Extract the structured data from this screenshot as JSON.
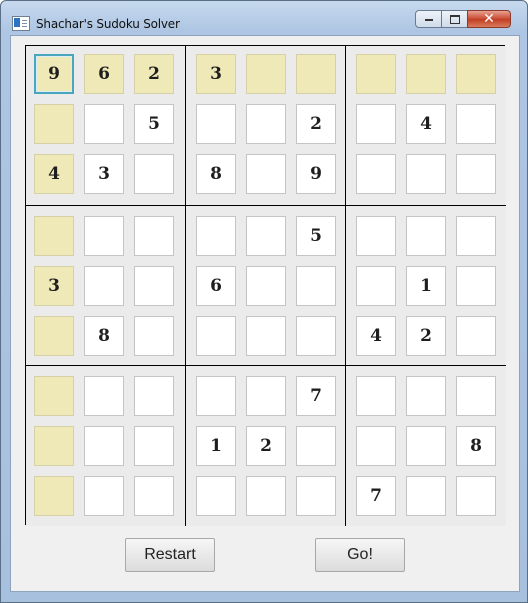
{
  "window": {
    "title": "Shachar's Sudoku Solver",
    "controls": {
      "minimize": "",
      "maximize": "",
      "close": "✕"
    }
  },
  "board": {
    "values": [
      [
        "9",
        "6",
        "2",
        "3",
        "",
        "",
        "",
        "",
        ""
      ],
      [
        "",
        "",
        "5",
        "",
        "",
        "2",
        "",
        "4",
        ""
      ],
      [
        "4",
        "3",
        "",
        "8",
        "",
        "9",
        "",
        "",
        ""
      ],
      [
        "",
        "",
        "",
        "",
        "",
        "5",
        "",
        "",
        ""
      ],
      [
        "3",
        "",
        "",
        "6",
        "",
        "",
        "",
        "1",
        ""
      ],
      [
        "",
        "8",
        "",
        "",
        "",
        "",
        "4",
        "2",
        ""
      ],
      [
        "",
        "",
        "",
        "",
        "",
        "7",
        "",
        "",
        ""
      ],
      [
        "",
        "",
        "",
        "1",
        "2",
        "",
        "",
        "",
        "8"
      ],
      [
        "",
        "",
        "",
        "",
        "",
        "",
        "7",
        "",
        ""
      ]
    ],
    "highlighted": [
      [
        1,
        1,
        1,
        1,
        1,
        1,
        1,
        1,
        1
      ],
      [
        1,
        0,
        0,
        0,
        0,
        0,
        0,
        0,
        0
      ],
      [
        1,
        0,
        0,
        0,
        0,
        0,
        0,
        0,
        0
      ],
      [
        1,
        0,
        0,
        0,
        0,
        0,
        0,
        0,
        0
      ],
      [
        1,
        0,
        0,
        0,
        0,
        0,
        0,
        0,
        0
      ],
      [
        1,
        0,
        0,
        0,
        0,
        0,
        0,
        0,
        0
      ],
      [
        1,
        0,
        0,
        0,
        0,
        0,
        0,
        0,
        0
      ],
      [
        1,
        0,
        0,
        0,
        0,
        0,
        0,
        0,
        0
      ],
      [
        1,
        0,
        0,
        0,
        0,
        0,
        0,
        0,
        0
      ]
    ],
    "focused_cell": [
      0,
      0
    ],
    "colors": {
      "highlight": "#efe8b7",
      "focus_ring": "#4aa6bf"
    }
  },
  "buttons": {
    "restart": "Restart",
    "go": "Go!"
  }
}
